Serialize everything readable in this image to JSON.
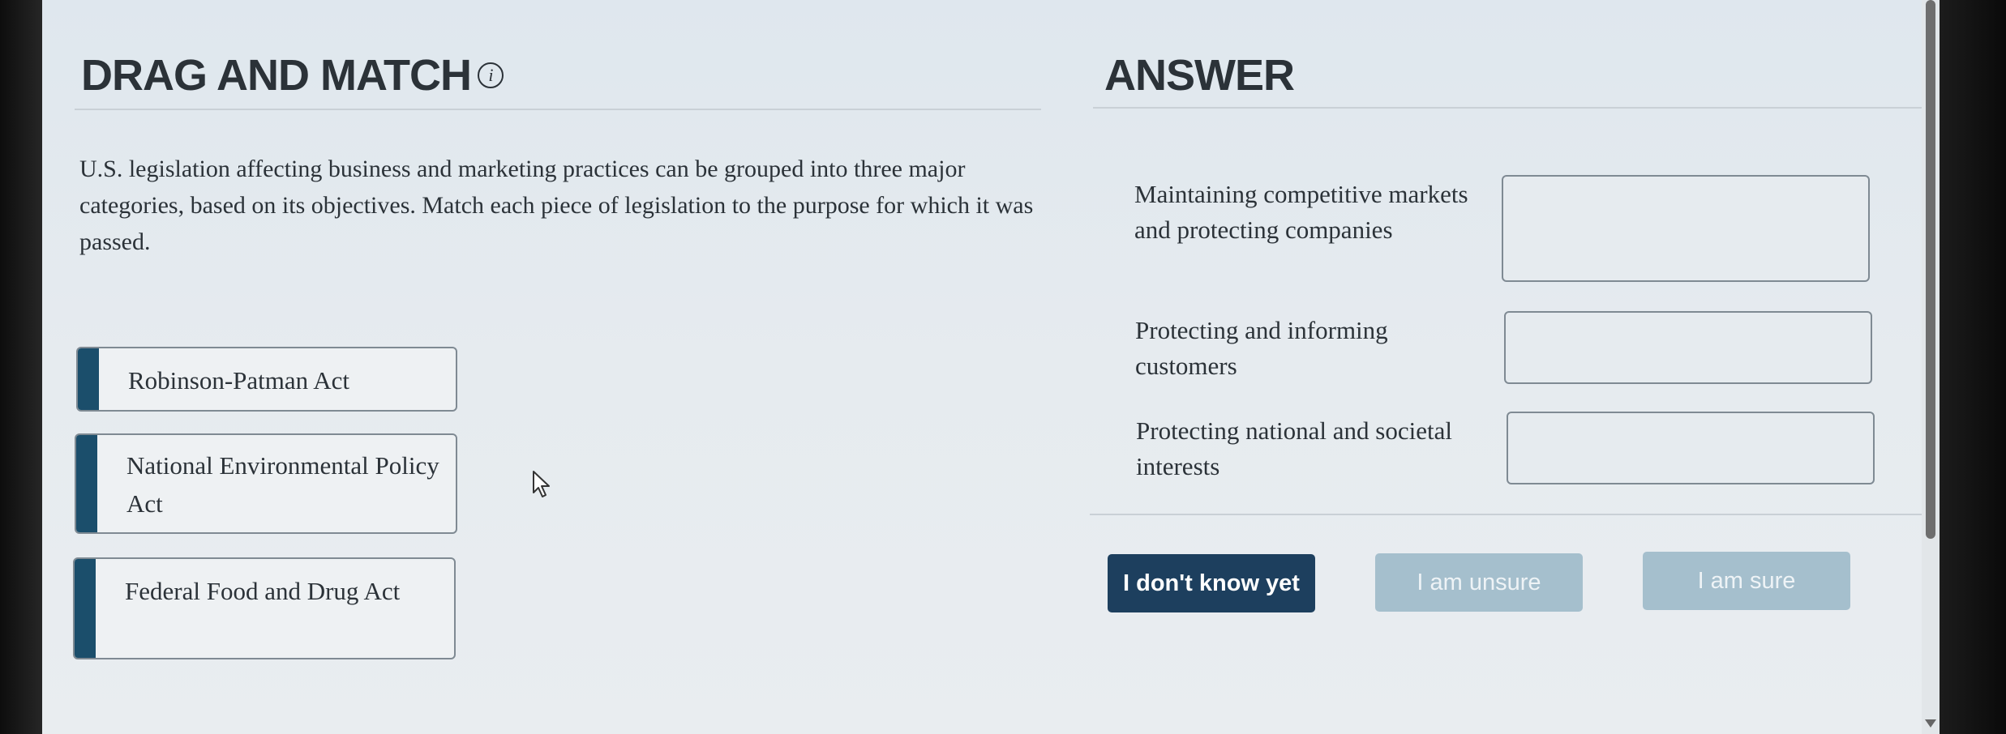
{
  "left_panel": {
    "title": "DRAG AND MATCH",
    "info_icon": "i",
    "prompt": "U.S. legislation affecting business and marketing practices can be grouped into three major categories, based on its objectives. Match each piece of legislation to the purpose for which it was passed.",
    "drag_items": [
      {
        "label": "Robinson-Patman Act"
      },
      {
        "label": "National Environmental Policy Act"
      },
      {
        "label": "Federal Food and Drug Act"
      }
    ]
  },
  "right_panel": {
    "title": "ANSWER",
    "targets": [
      {
        "label": "Maintaining competitive markets and protecting companies",
        "value": ""
      },
      {
        "label": "Protecting and informing customers",
        "value": ""
      },
      {
        "label": "Protecting national and societal interests",
        "value": ""
      }
    ]
  },
  "buttons": {
    "dont_know": "I don't know yet",
    "unsure": "I am unsure",
    "sure": "I am sure"
  },
  "colors": {
    "primary": "#1d3f5e",
    "disabled": "#a5bfcd",
    "handle": "#1b4e6b"
  }
}
